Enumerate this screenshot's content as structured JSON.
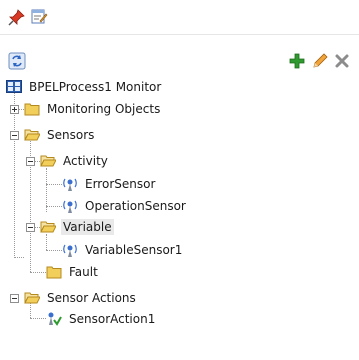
{
  "toolbar": {
    "pin_icon": "pin-icon",
    "edit_icon": "edit-document-icon"
  },
  "actions": {
    "refresh_icon": "refresh-icon",
    "add_icon": "add-icon",
    "edit_icon": "pencil-icon",
    "delete_icon": "delete-icon"
  },
  "tree": {
    "root": "BPELProcess1 Monitor",
    "monitoring_objects": "Monitoring Objects",
    "sensors": "Sensors",
    "activity": "Activity",
    "error_sensor": "ErrorSensor",
    "operation_sensor": "OperationSensor",
    "variable": "Variable",
    "variable_sensor": "VariableSensor1",
    "fault": "Fault",
    "sensor_actions": "Sensor Actions",
    "sensor_action": "SensorAction1"
  },
  "colors": {
    "add": "#2f9a2f",
    "pencil": "#e08a1c",
    "delete": "#8c8c8c",
    "folder": "#f2cf5b",
    "selection": "#e9e9e9"
  }
}
